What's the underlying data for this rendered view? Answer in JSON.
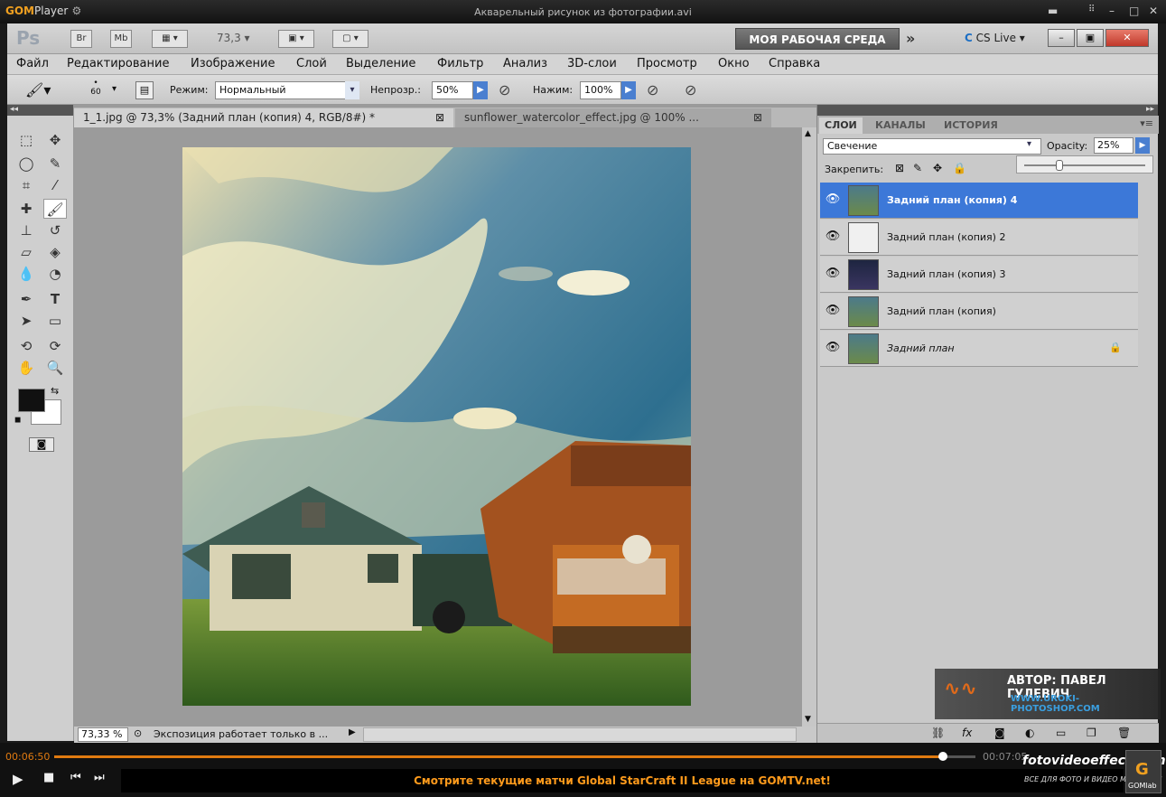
{
  "gom": {
    "logo_brand": "GOM",
    "logo_rest": "Player",
    "window_title": "Акварельный рисунок из фотографии.avi",
    "time_current": "00:06:50",
    "time_total": "00:07:05",
    "progress": 0.965,
    "ticker": "Смотрите текущие матчи Global StarCraft II League на GOMTV.net!",
    "site_watermark": "fotovideoeffect.com",
    "site_tagline": "ВСЕ ДЛЯ ФОТО И ВИДЕО МОНТАЖА!",
    "gomlab": "GOMlab"
  },
  "ps": {
    "logo": "Ps",
    "br_label": "Br",
    "mb_label": "Mb",
    "zoom_display": "73,3",
    "workspace": "МОЯ РАБОЧАЯ СРЕДА",
    "cs_live": "CS Live",
    "menu": [
      "Файл",
      "Редактирование",
      "Изображение",
      "Слой",
      "Выделение",
      "Фильтр",
      "Анализ",
      "3D-слои",
      "Просмотр",
      "Окно",
      "Справка"
    ],
    "options": {
      "brush_size": "60",
      "mode_label": "Режим:",
      "mode_value": "Нормальный",
      "opacity_label": "Непрозр.:",
      "opacity_value": "50%",
      "flow_label": "Нажим:",
      "flow_value": "100%"
    },
    "doc_tabs": [
      {
        "label": "1_1.jpg @ 73,3% (Задний план (копия) 4, RGB/8#) *"
      },
      {
        "label": "sunflower_watercolor_effect.jpg @ 100% ..."
      }
    ],
    "status": {
      "zoom": "73,33 %",
      "info": "Экспозиция работает только в ..."
    },
    "layers_panel": {
      "tabs": [
        "СЛОИ",
        "КАНАЛЫ",
        "ИСТОРИЯ"
      ],
      "blend_mode": "Свечение",
      "opacity_label": "Opacity:",
      "opacity_value": "25%",
      "lock_label": "Закрепить:",
      "layers": [
        {
          "name": "Задний план (копия) 4",
          "selected": true
        },
        {
          "name": "Задний план (копия) 2",
          "selected": false
        },
        {
          "name": "Задний план (копия) 3",
          "selected": false
        },
        {
          "name": "Задний план (копия)",
          "selected": false
        },
        {
          "name": "Задний план",
          "selected": false,
          "locked": true
        }
      ]
    },
    "author_watermark": "АВТОР: ПАВЕЛ ГУЛЕВИЧ",
    "author_site": "WWW.UROKI-PHOTOSHOP.COM"
  }
}
